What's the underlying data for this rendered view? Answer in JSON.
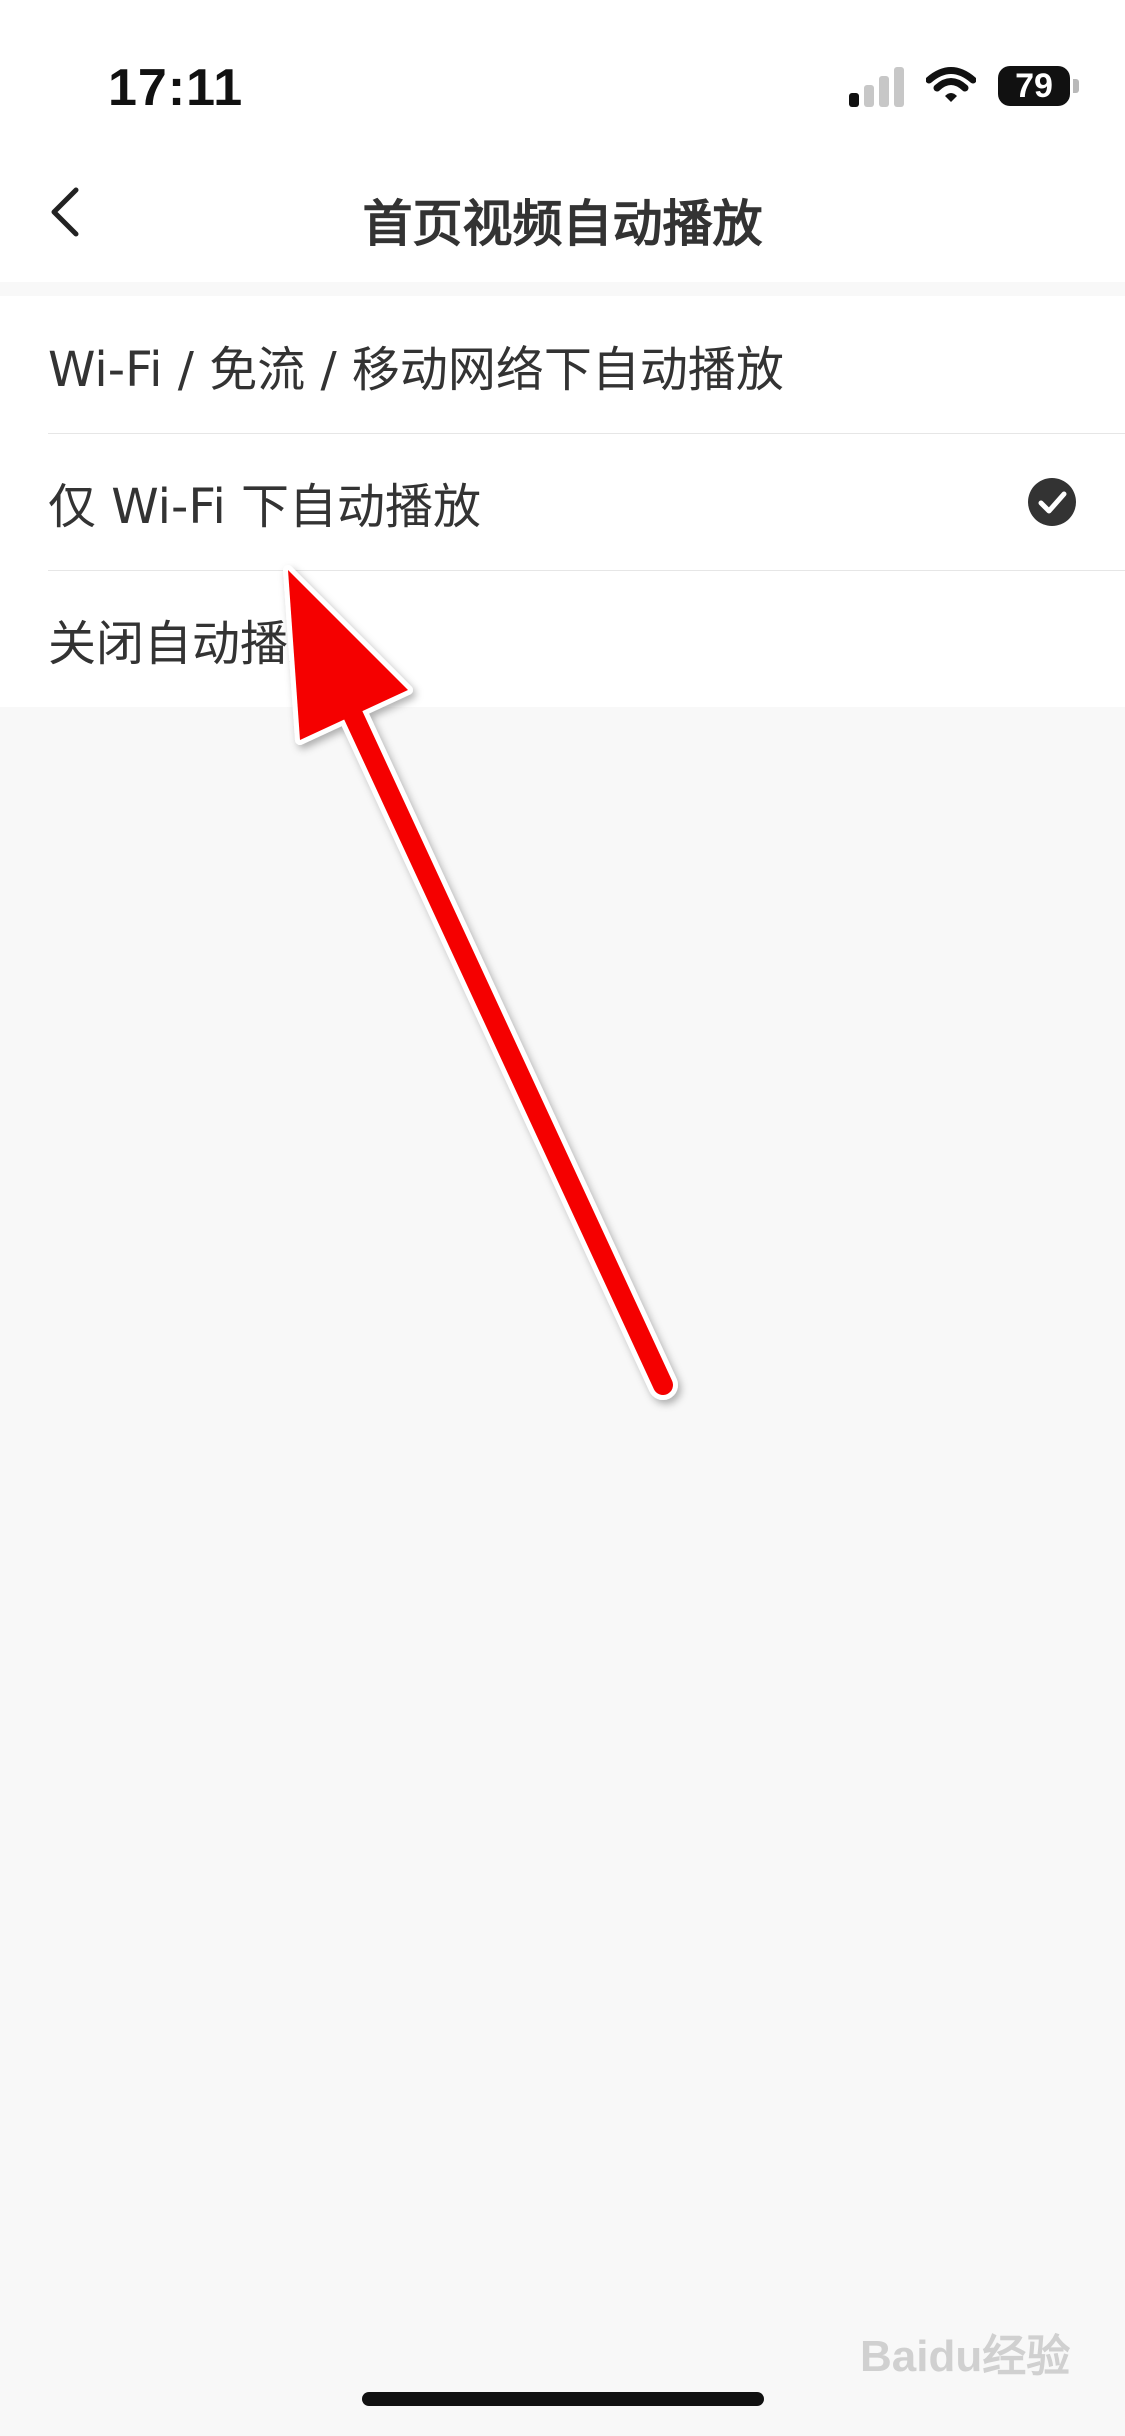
{
  "status_bar": {
    "time": "17:11",
    "battery_level": "79",
    "signal_icon": "signal-icon",
    "wifi_icon": "wifi-icon"
  },
  "nav": {
    "back_icon": "chevron-left-icon",
    "title": "首页视频自动播放"
  },
  "options": [
    {
      "label": "Wi-Fi / 免流 / 移动网络下自动播放",
      "selected": false
    },
    {
      "label": "仅 Wi-Fi 下自动播放",
      "selected": true
    },
    {
      "label": "关闭自动播放",
      "selected": false
    }
  ],
  "annotation": {
    "arrow_color": "#f50000"
  },
  "watermark": "Baidu经验"
}
